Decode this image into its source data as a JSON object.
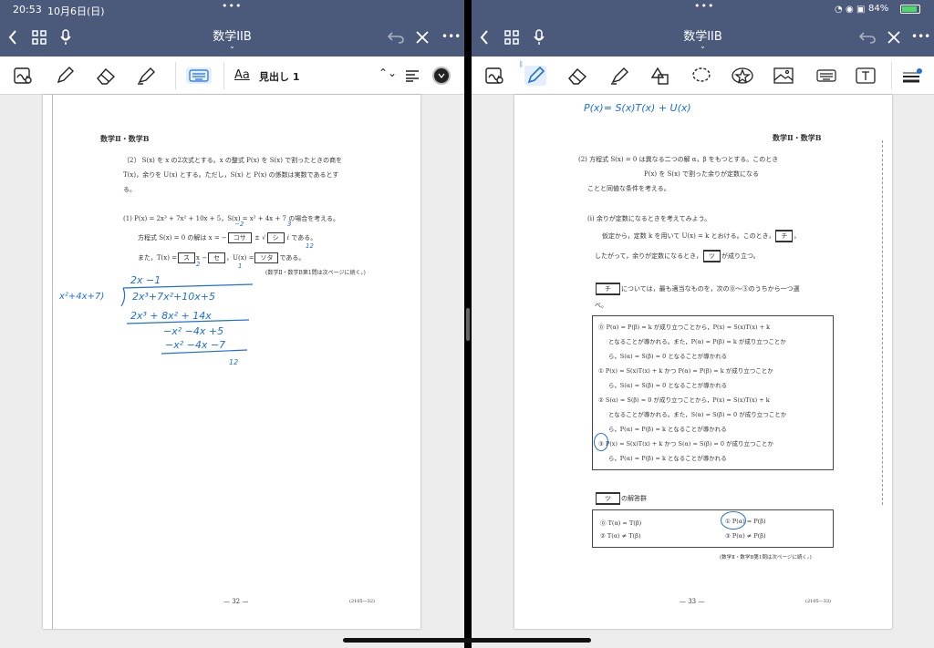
{
  "status": {
    "time": "20:53",
    "date": "10月6日(日)",
    "battery": "84%"
  },
  "left": {
    "title": "数学IIB",
    "style_label": "見出し 1",
    "aa_label": "Aa",
    "page": {
      "header": "数学Ⅱ・数学B",
      "q2a": "〔2〕 S(x) を x の2次式とする。x の整式 P(x) を S(x) で割ったときの商を",
      "q2b": "T(x)，余りを U(x) とする。ただし，S(x) と P(x) の係数は実数であるとす",
      "q2c": "る。",
      "p1": "(1) P(x) = 2x³ + 7x² + 10x + 5，S(x) = x² + 4x + 7 の場合を考える。",
      "eq1a": "方程式 S(x) = 0 の解は x =",
      "eq1b": "である。",
      "eq2a": "また，T(x) =",
      "eq2b": "x −",
      "eq2c": "，U(x) =",
      "eq2d": "である。",
      "box_kosa": "コサ",
      "box_shi": "シ",
      "box_su": "ス",
      "box_se": "セ",
      "box_sota": "ソタ",
      "note": "(数学Ⅱ・数学B第1問は次ページに続く。)",
      "footer": "— 32 —",
      "code": "(2105—32)"
    },
    "hand": {
      "h1": "2x −1",
      "h2": "x²+4x+7)",
      "h3": "2x³+7x²+10x+5",
      "h4": "2x³ + 8x² + 14x",
      "h5": "−x² −4x +5",
      "h6": "−x² −4x −7",
      "h7": "12",
      "m1": "−2",
      "m2": "3",
      "m3": "12",
      "m4": "2",
      "m5": "1"
    }
  },
  "right": {
    "title": "数学IIB",
    "page": {
      "header": "数学Ⅱ・数学B",
      "q2a": "(2) 方程式 S(x) = 0 は異なる二つの解 α，β をもつとする。このとき",
      "q2b": "P(x) を S(x) で割った余りが定数になる",
      "q2c": "ことと同値な条件を考える。",
      "i1": "(i) 余りが定数になるときを考えてみよう。",
      "i2a": "仮定から，定数 k を用いて U(x) = k とおける。このとき，",
      "i3a": "したがって，余りが定数になるとき，",
      "i3b": "が成り立つ。",
      "box_chi": "チ",
      "box_tsu": "ツ",
      "q3a": "については，最も適当なものを，次の⓪〜③のうちから一つ選",
      "q3b": "べ。",
      "c0a": "⓪ P(α) = P(β) = k が成り立つことから，P(x) = S(x)T(x) + k",
      "c0b": "となることが導かれる。また，P(α) = P(β) = k が成り立つことか",
      "c0c": "ら，S(α) = S(β) = 0 となることが導かれる",
      "c1a": "① P(x) = S(x)T(x) + k かつ P(α) = P(β) = k が成り立つことか",
      "c1b": "ら，S(α) = S(β) = 0 となることが導かれる",
      "c2a": "② S(α) = S(β) = 0 が成り立つことから，P(x) = S(x)T(x) + k",
      "c2b": "となることが導かれる。また，S(α) = S(β) = 0 が成り立つことか",
      "c2c": "ら，P(α) = P(β) = k となることが導かれる",
      "c3a": "③ P(x) = S(x)T(x) + k かつ S(α) = S(β) = 0 が成り立つことか",
      "c3b": "ら，P(α) = P(β) = k となることが導かれる",
      "ans_label": "の解答群",
      "a0": "⓪ T(α) = T(β)",
      "a1": "① P(α) = P(β)",
      "a2": "② T(α) ≠ T(β)",
      "a3": "③ P(α) ≠ P(β)",
      "note": "(数学Ⅱ・数学B第1問は次ページに続く。)",
      "footer": "— 33 —",
      "code": "(2105—33)"
    },
    "hand": {
      "h1": "P(x)= S(x)T(x) + U(x)"
    }
  }
}
